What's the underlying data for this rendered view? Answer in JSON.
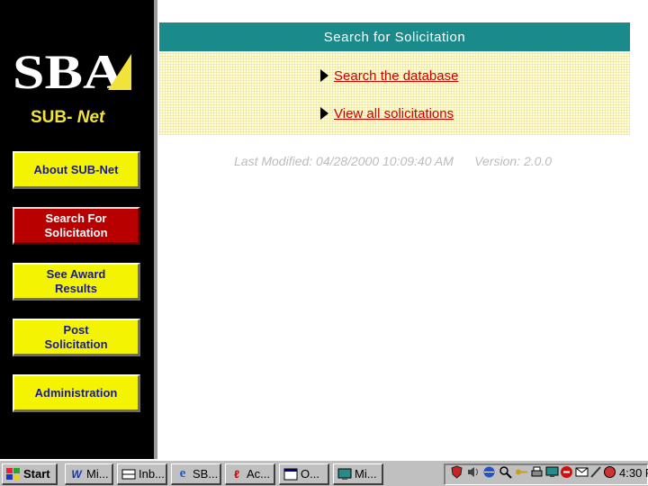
{
  "sidebar": {
    "logo_text": "SBA",
    "brand_prefix": "SUB-",
    "brand_suffix": " Net",
    "nav": [
      {
        "label": "About SUB-Net"
      },
      {
        "label": "Search For Solicitation"
      },
      {
        "label": "See Award Results"
      },
      {
        "label": "Post Solicitation"
      },
      {
        "label": "Administration"
      }
    ]
  },
  "main": {
    "header": "Search for Solicitation",
    "links": [
      {
        "label": "Search the database"
      },
      {
        "label": "View all solicitations"
      }
    ],
    "modified": "Last Modified: 04/28/2000 10:09:40 AM      Version: 2.0.0"
  },
  "taskbar": {
    "start_label": "Start",
    "tasks": [
      {
        "label": "Mi..."
      },
      {
        "label": "Inb..."
      },
      {
        "label": "SB..."
      },
      {
        "label": "Ac..."
      },
      {
        "label": "O..."
      },
      {
        "label": "Mi..."
      }
    ],
    "clock": "4:30 P"
  },
  "colors": {
    "header_teal": "#1a8a8a",
    "nav_yellow": "#f4f400",
    "nav_active": "#b80000",
    "link_red": "#cc0000",
    "brand_yellow": "#f2e33a"
  }
}
